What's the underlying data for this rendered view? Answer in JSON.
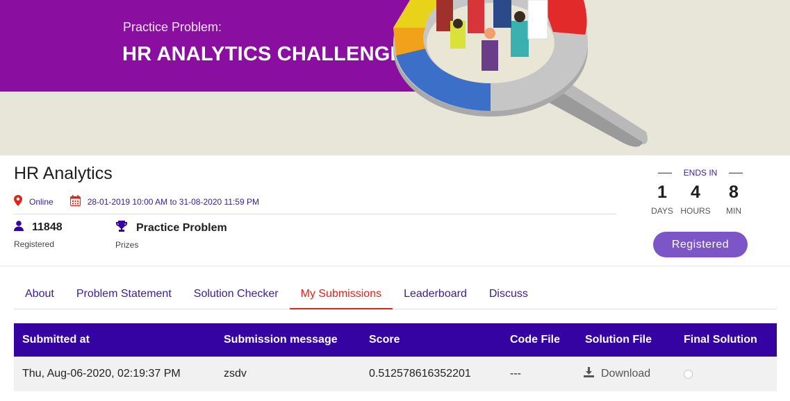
{
  "banner": {
    "subtitle": "Practice Problem:",
    "title": "HR ANALYTICS CHALLENGE"
  },
  "event": {
    "title": "HR Analytics",
    "location": "Online",
    "dates": "28-01-2019 10:00 AM to 31-08-2020 11:59 PM",
    "registered_count": "11848",
    "registered_label": "Registered",
    "prize": "Practice Problem",
    "prize_label": "Prizes"
  },
  "countdown": {
    "label": "ENDS IN",
    "days": "1",
    "days_label": "DAYS",
    "hours": "4",
    "hours_label": "HOURS",
    "min": "8",
    "min_label": "MIN"
  },
  "register_button": "Registered",
  "tabs": [
    {
      "label": "About",
      "active": false
    },
    {
      "label": "Problem Statement",
      "active": false
    },
    {
      "label": "Solution Checker",
      "active": false
    },
    {
      "label": "My Submissions",
      "active": true
    },
    {
      "label": "Leaderboard",
      "active": false
    },
    {
      "label": "Discuss",
      "active": false
    }
  ],
  "table": {
    "headers": [
      "Submitted at",
      "Submission message",
      "Score",
      "Code File",
      "Solution File",
      "Final Solution"
    ],
    "rows": [
      {
        "submitted_at": "Thu, Aug-06-2020, 02:19:37 PM",
        "message": "zsdv",
        "score": "0.512578616352201",
        "code_file": "---",
        "solution_file": "Download",
        "final_selected": false
      }
    ]
  },
  "icons": {
    "location": "map-pin-icon",
    "calendar": "calendar-icon",
    "user": "user-icon",
    "trophy": "trophy-icon",
    "download": "download-icon"
  },
  "colors": {
    "banner_purple": "#8a0ea0",
    "header_purple": "#3503a2",
    "accent_red": "#e2231a",
    "link_purple": "#3b1c94",
    "button_purple": "#7c55c6"
  }
}
